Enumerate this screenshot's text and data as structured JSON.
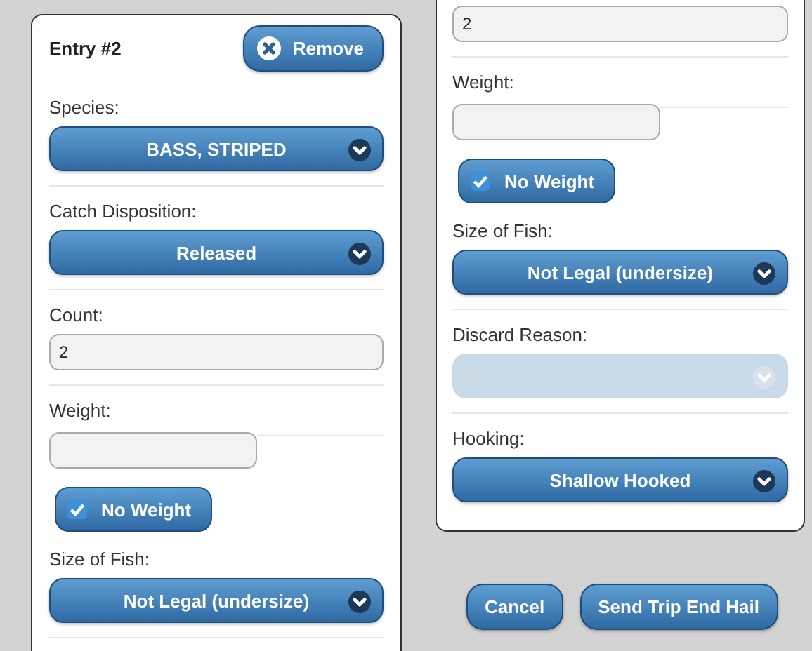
{
  "left_panel": {
    "title": "Entry #2",
    "remove_button": "Remove",
    "fields": [
      {
        "kind": "select",
        "label": "Species:",
        "value": "BASS, STRIPED",
        "disabled": false
      },
      {
        "kind": "select",
        "label": "Catch Disposition:",
        "value": "Released",
        "disabled": false
      },
      {
        "kind": "text",
        "label": "Count:",
        "value": "2"
      },
      {
        "kind": "weight",
        "label": "Weight:",
        "toggle": "No Weight",
        "checked": true
      },
      {
        "kind": "select",
        "label": "Size of Fish:",
        "value": "Not Legal (undersize)",
        "disabled": false
      }
    ]
  },
  "right_panel": {
    "fields": [
      {
        "kind": "text",
        "value": "2"
      },
      {
        "kind": "weight",
        "label": "Weight:",
        "toggle": "No Weight",
        "checked": true
      },
      {
        "kind": "select",
        "label": "Size of Fish:",
        "value": "Not Legal (undersize)",
        "disabled": false
      },
      {
        "kind": "select",
        "label": "Discard Reason:",
        "disabled": true
      },
      {
        "kind": "select",
        "label": "Hooking:",
        "value": "Shallow Hooked",
        "disabled": false
      }
    ]
  },
  "buttons": [
    "Cancel",
    "Send Trip End Hail"
  ]
}
